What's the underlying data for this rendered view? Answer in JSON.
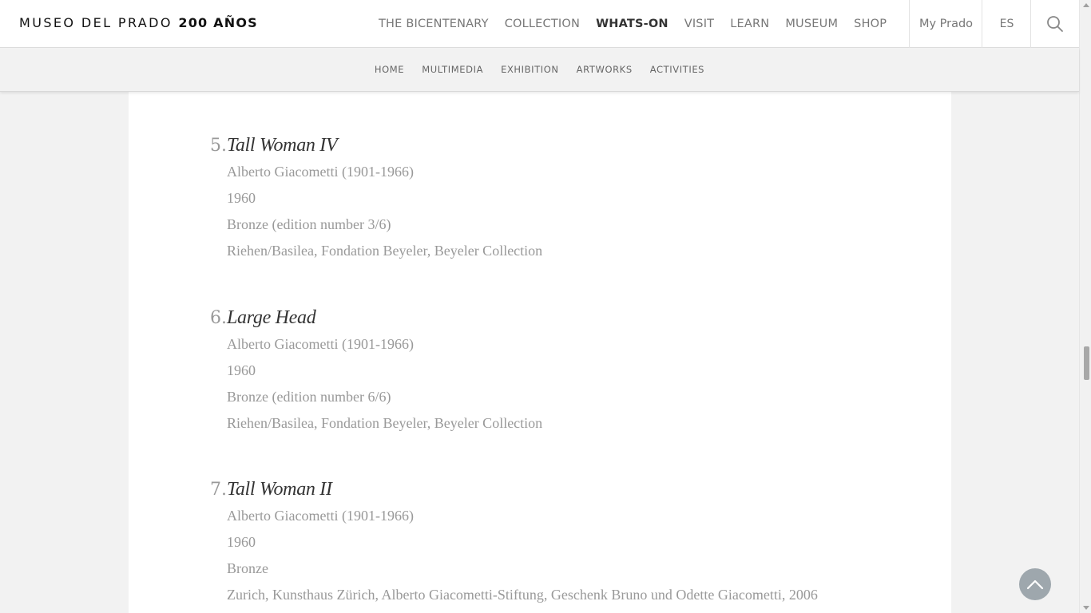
{
  "header": {
    "logo_text": "MUSEO DEL PRADO",
    "logo_strong": "200 AÑOS",
    "nav": [
      {
        "label": "THE BICENTENARY"
      },
      {
        "label": "COLLECTION"
      },
      {
        "label": "WHATS-ON"
      },
      {
        "label": "VISIT"
      },
      {
        "label": "LEARN"
      },
      {
        "label": "MUSEUM"
      },
      {
        "label": "SHOP"
      }
    ],
    "active_nav": "WHATS-ON",
    "my_prado": "My Prado",
    "language": "ES",
    "search_icon": "search-icon"
  },
  "subnav": [
    {
      "label": "HOME"
    },
    {
      "label": "MULTIMEDIA"
    },
    {
      "label": "EXHIBITION"
    },
    {
      "label": "ARTWORKS"
    },
    {
      "label": "ACTIVITIES"
    }
  ],
  "works": [
    {
      "number": "5.",
      "title": "Tall Woman IV",
      "artist": "Alberto Giacometti (1901-1966)",
      "date": "1960",
      "medium": "Bronze (edition number 3/6)",
      "location": "Riehen/Basilea, Fondation Beyeler, Beyeler Collection"
    },
    {
      "number": "6.",
      "title": "Large Head",
      "artist": "Alberto Giacometti (1901-1966)",
      "date": "1960",
      "medium": "Bronze (edition number 6/6)",
      "location": "Riehen/Basilea, Fondation Beyeler, Beyeler Collection"
    },
    {
      "number": "7.",
      "title": "Tall Woman II",
      "artist": "Alberto Giacometti (1901-1966)",
      "date": "1960",
      "medium": "Bronze",
      "location": "Zurich, Kunsthaus Zürich, Alberto Giacometti-Stiftung, Geschenk Bruno und Odette Giacometti, 2006"
    }
  ],
  "back_to_top_icon": "chevron-up-icon",
  "colors": {
    "page_bg": "#f2f2f2",
    "card_bg": "#ffffff",
    "title_text": "#333333",
    "meta_text": "#999999",
    "back_to_top_bg": "#9ea7ad"
  }
}
